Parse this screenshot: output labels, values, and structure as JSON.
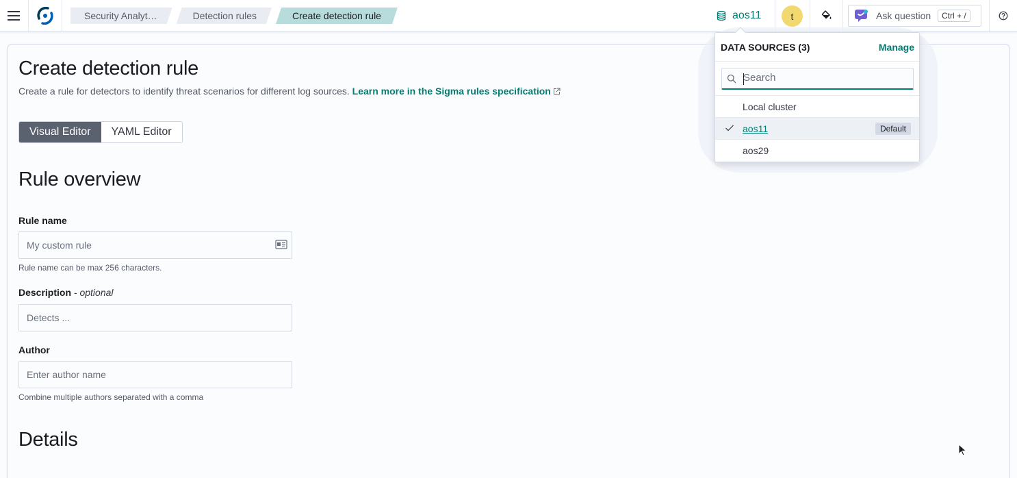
{
  "header": {
    "breadcrumbs": [
      "Security Analyt…",
      "Detection rules",
      "Create detection rule"
    ],
    "data_source_label": "aos11",
    "avatar_initial": "t",
    "ask_placeholder": "Ask question",
    "ask_shortcut": "Ctrl + /"
  },
  "page": {
    "title": "Create detection rule",
    "subtitle": "Create a rule for detectors to identify threat scenarios for different log sources.",
    "subtitle_link": "Learn more in the Sigma rules specification",
    "editor_tabs": [
      "Visual Editor",
      "YAML Editor"
    ],
    "active_tab": "Visual Editor"
  },
  "form": {
    "section_overview": "Rule overview",
    "rule_name_label": "Rule name",
    "rule_name_placeholder": "My custom rule",
    "rule_name_help": "Rule name can be max 256 characters.",
    "description_label": "Description",
    "description_optional": "- optional",
    "description_placeholder": "Detects ...",
    "author_label": "Author",
    "author_placeholder": "Enter author name",
    "author_help": "Combine multiple authors separated with a comma",
    "section_details": "Details"
  },
  "data_sources": {
    "title": "DATA SOURCES (3)",
    "manage": "Manage",
    "search_placeholder": "Search",
    "options": [
      {
        "label": "Local cluster",
        "selected": false,
        "default": false
      },
      {
        "label": "aos11",
        "selected": true,
        "default": true
      },
      {
        "label": "aos29",
        "selected": false,
        "default": false
      }
    ],
    "default_badge": "Default"
  },
  "colors": {
    "accent": "#017d73",
    "active_tab": "#5a6270",
    "breadcrumb_active": "#b8dcdb",
    "avatar": "#f1d86f"
  }
}
